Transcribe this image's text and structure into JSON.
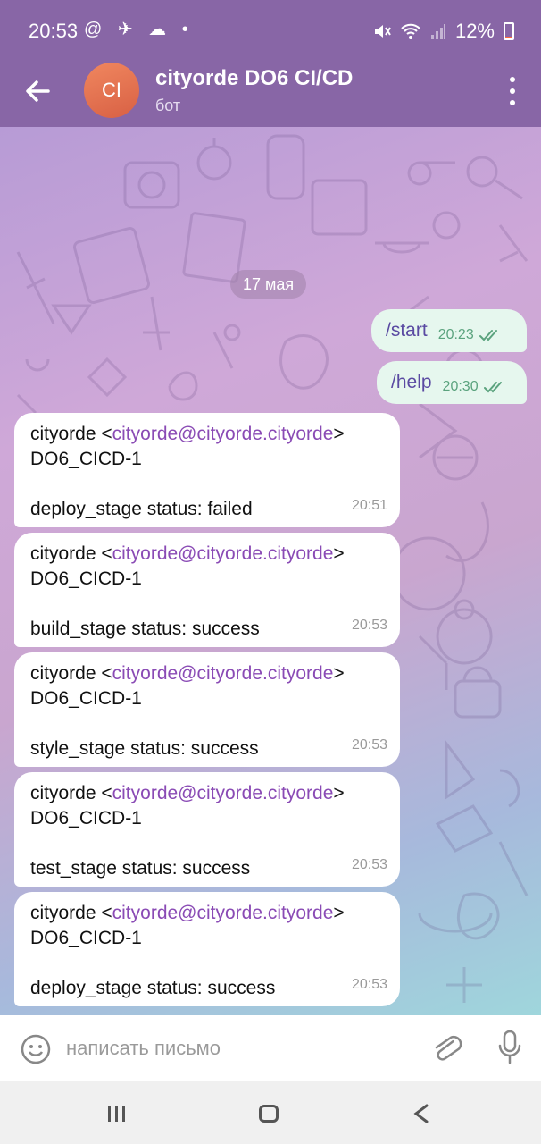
{
  "status_bar": {
    "time": "20:53",
    "left_icons": "@ ✈ ☁ •",
    "battery": "12%",
    "battery_level": 0.12
  },
  "header": {
    "avatar_initials": "CI",
    "title": "cityorde DO6 CI/CD",
    "subtitle": "бот"
  },
  "chat": {
    "date": "17 мая",
    "outgoing": [
      {
        "text": "/start",
        "time": "20:23"
      },
      {
        "text": "/help",
        "time": "20:30"
      }
    ],
    "incoming": [
      {
        "name": "cityorde",
        "email": "cityorde@cityorde.cityorde",
        "project": "DO6_CICD-1",
        "status": "deploy_stage status: failed",
        "time": "20:51"
      },
      {
        "name": "cityorde",
        "email": "cityorde@cityorde.cityorde",
        "project": "DO6_CICD-1",
        "status": "build_stage status: success",
        "time": "20:53"
      },
      {
        "name": "cityorde",
        "email": "cityorde@cityorde.cityorde",
        "project": "DO6_CICD-1",
        "status": "style_stage status: success",
        "time": "20:53"
      },
      {
        "name": "cityorde",
        "email": "cityorde@cityorde.cityorde",
        "project": "DO6_CICD-1",
        "status": "test_stage status: success",
        "time": "20:53"
      },
      {
        "name": "cityorde",
        "email": "cityorde@cityorde.cityorde",
        "project": "DO6_CICD-1",
        "status": "deploy_stage status: success",
        "time": "20:53"
      }
    ]
  },
  "composer": {
    "placeholder": "написать письмо"
  },
  "colors": {
    "header": "#8866a6",
    "link": "#8a4bb5",
    "outgoing_bubble": "#e6f7ee"
  }
}
